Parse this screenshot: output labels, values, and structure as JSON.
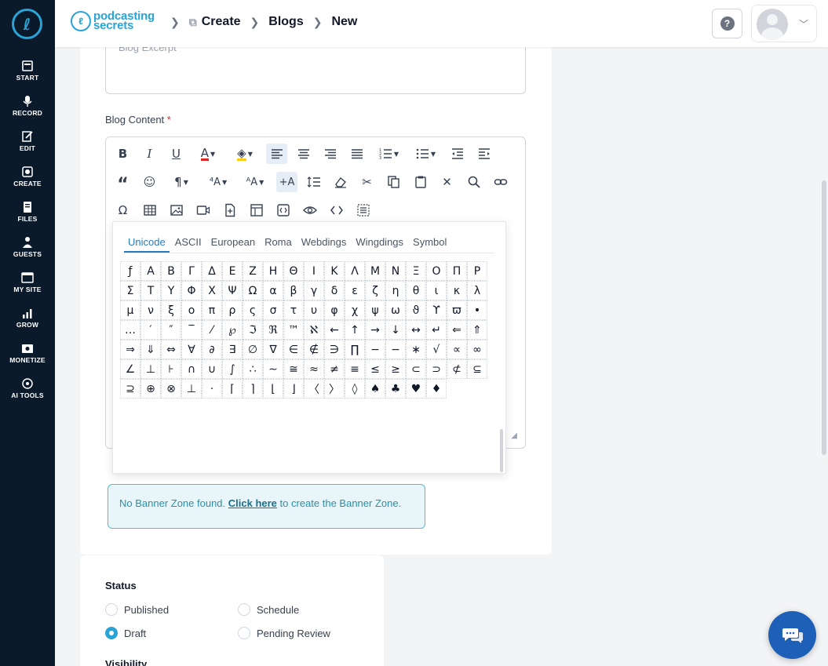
{
  "sidebar": {
    "logo_icon": "podcasting-secrets-logo",
    "items": [
      {
        "label": "START",
        "icon": "start-icon"
      },
      {
        "label": "RECORD",
        "icon": "mic-icon"
      },
      {
        "label": "EDIT",
        "icon": "edit-icon"
      },
      {
        "label": "CREATE",
        "icon": "create-icon"
      },
      {
        "label": "FILES",
        "icon": "files-icon"
      },
      {
        "label": "GUESTS",
        "icon": "guests-icon"
      },
      {
        "label": "MY SITE",
        "icon": "site-icon"
      },
      {
        "label": "GROW",
        "icon": "grow-icon"
      },
      {
        "label": "MONETIZE",
        "icon": "monetize-icon"
      },
      {
        "label": "AI TOOLS",
        "icon": "ai-icon"
      }
    ]
  },
  "topbar": {
    "brand_line1": "podcasting",
    "brand_line2": "secrets",
    "breadcrumb": [
      "Create",
      "Blogs",
      "New"
    ],
    "help_label": "?"
  },
  "form": {
    "excerpt_placeholder": "Blog Excerpt",
    "content_label": "Blog Content",
    "required_mark": "*"
  },
  "charmap": {
    "tabs": [
      "Unicode",
      "ASCII",
      "European",
      "Roma",
      "Webdings",
      "Wingdings",
      "Symbol"
    ],
    "active_tab": "Unicode",
    "chars": [
      "ƒ",
      "Α",
      "Β",
      "Γ",
      "Δ",
      "Ε",
      "Ζ",
      "Η",
      "Θ",
      "Ι",
      "Κ",
      "Λ",
      "Μ",
      "Ν",
      "Ξ",
      "Ο",
      "Π",
      "Ρ",
      "Σ",
      "Τ",
      "Υ",
      "Φ",
      "Χ",
      "Ψ",
      "Ω",
      "α",
      "β",
      "γ",
      "δ",
      "ε",
      "ζ",
      "η",
      "θ",
      "ι",
      "κ",
      "λ",
      "μ",
      "ν",
      "ξ",
      "ο",
      "π",
      "ρ",
      "ς",
      "σ",
      "τ",
      "υ",
      "φ",
      "χ",
      "ψ",
      "ω",
      "ϑ",
      "ϒ",
      "ϖ",
      "•",
      "…",
      "′",
      "″",
      "‾",
      "⁄",
      "℘",
      "ℑ",
      "ℜ",
      "™",
      "ℵ",
      "←",
      "↑",
      "→",
      "↓",
      "↔",
      "↵",
      "⇐",
      "⇑",
      "⇒",
      "⇓",
      "⇔",
      "∀",
      "∂",
      "∃",
      "∅",
      "∇",
      "∈",
      "∉",
      "∋",
      "∏",
      "−",
      "−",
      "∗",
      "√",
      "∝",
      "∞",
      "∠",
      "⊥",
      "⊦",
      "∩",
      "∪",
      "∫",
      "∴",
      "∼",
      "≅",
      "≈",
      "≠",
      "≡",
      "≤",
      "≥",
      "⊂",
      "⊃",
      "⊄",
      "⊆",
      "⊇",
      "⊕",
      "⊗",
      "⊥",
      "⋅",
      "⌈",
      "⌉",
      "⌊",
      "⌋",
      "〈",
      "〉",
      "◊",
      "♠",
      "♣",
      "♥",
      "♦"
    ]
  },
  "banner": {
    "text_before": "No Banner Zone found. ",
    "link": "Click here",
    "text_after": " to create the Banner Zone."
  },
  "status": {
    "title": "Status",
    "options": [
      "Published",
      "Schedule",
      "Draft",
      "Pending Review"
    ],
    "selected": "Draft",
    "visibility_title": "Visibility"
  },
  "colors": {
    "sidebar_bg": "#0b1a2b",
    "accent": "#2aa3d6",
    "chat_button": "#1e5fb8"
  }
}
